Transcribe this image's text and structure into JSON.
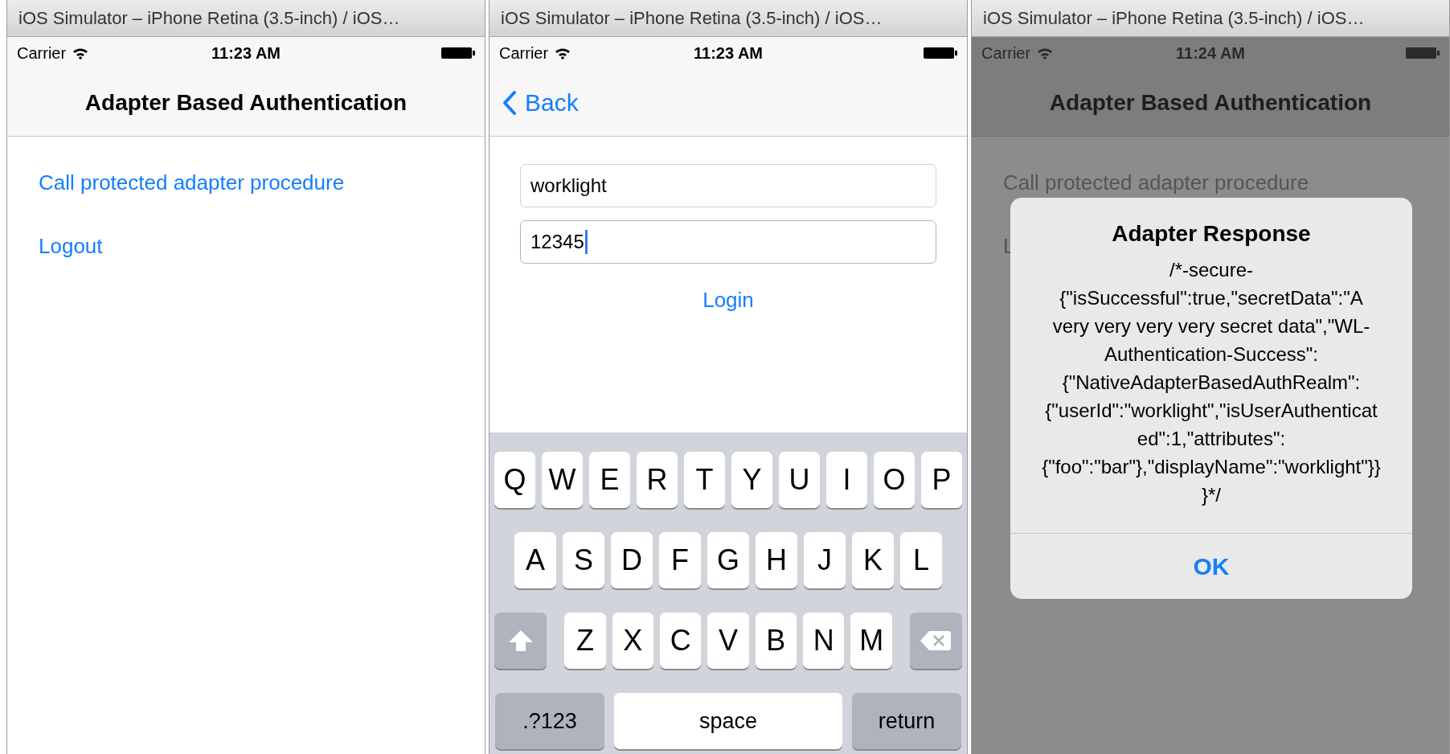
{
  "windows": [
    {
      "title": "iOS Simulator – iPhone Retina (3.5-inch) / iOS…",
      "status_bar": {
        "carrier": "Carrier",
        "time": "11:23 AM"
      },
      "screen": {
        "kind": "menu",
        "nav_title": "Adapter Based Authentication",
        "links": [
          "Call protected adapter procedure",
          "Logout"
        ]
      }
    },
    {
      "title": "iOS Simulator – iPhone Retina (3.5-inch) / iOS…",
      "status_bar": {
        "carrier": "Carrier",
        "time": "11:23 AM"
      },
      "screen": {
        "kind": "login",
        "back": "Back",
        "fields": [
          {
            "value": "worklight",
            "focused": false
          },
          {
            "value": "12345",
            "focused": true
          }
        ],
        "button": "Login",
        "keyboard": [
          [
            {
              "kind": "letter",
              "label": "Q"
            },
            {
              "kind": "letter",
              "label": "W"
            },
            {
              "kind": "letter",
              "label": "E"
            },
            {
              "kind": "letter",
              "label": "R"
            },
            {
              "kind": "letter",
              "label": "T"
            },
            {
              "kind": "letter",
              "label": "Y"
            },
            {
              "kind": "letter",
              "label": "U"
            },
            {
              "kind": "letter",
              "label": "I"
            },
            {
              "kind": "letter",
              "label": "O"
            },
            {
              "kind": "letter",
              "label": "P"
            }
          ],
          [
            {
              "kind": "letter",
              "label": "A"
            },
            {
              "kind": "letter",
              "label": "S"
            },
            {
              "kind": "letter",
              "label": "D"
            },
            {
              "kind": "letter",
              "label": "F"
            },
            {
              "kind": "letter",
              "label": "G"
            },
            {
              "kind": "letter",
              "label": "H"
            },
            {
              "kind": "letter",
              "label": "J"
            },
            {
              "kind": "letter",
              "label": "K"
            },
            {
              "kind": "letter",
              "label": "L"
            }
          ],
          [
            {
              "kind": "shift"
            },
            {
              "kind": "letter",
              "label": "Z"
            },
            {
              "kind": "letter",
              "label": "X"
            },
            {
              "kind": "letter",
              "label": "C"
            },
            {
              "kind": "letter",
              "label": "V"
            },
            {
              "kind": "letter",
              "label": "B"
            },
            {
              "kind": "letter",
              "label": "N"
            },
            {
              "kind": "letter",
              "label": "M"
            },
            {
              "kind": "delete"
            }
          ],
          [
            {
              "kind": "mode",
              "label": ".?123"
            },
            {
              "kind": "space",
              "label": "space"
            },
            {
              "kind": "return",
              "label": "return"
            }
          ]
        ]
      }
    },
    {
      "title": "iOS Simulator – iPhone Retina (3.5-inch) / iOS…",
      "status_bar": {
        "carrier": "Carrier",
        "time": "11:24 AM"
      },
      "screen": {
        "kind": "alert",
        "nav_title": "Adapter Based Authentication",
        "links": [
          "Call protected adapter procedure",
          "L"
        ],
        "alert": {
          "title": "Adapter Response",
          "message": "/*-secure-{\"isSuccessful\":true,\"secretData\":\"A very very very very secret data\",\"WL-Authentication-Success\":{\"NativeAdapterBasedAuthRealm\":{\"userId\":\"worklight\",\"isUserAuthenticated\":1,\"attributes\":{\"foo\":\"bar\"},\"displayName\":\"worklight\"}}}*/",
          "button": "OK"
        }
      }
    }
  ]
}
